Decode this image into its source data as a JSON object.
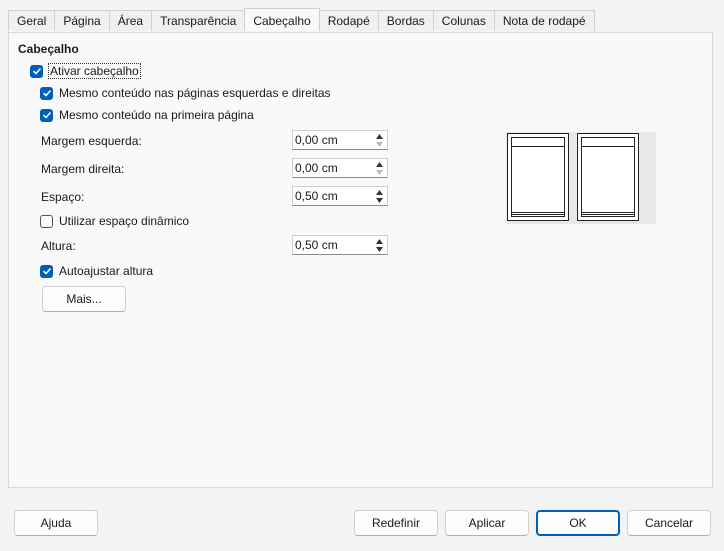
{
  "tabs": [
    "Geral",
    "Página",
    "Área",
    "Transparência",
    "Cabeçalho",
    "Rodapé",
    "Bordas",
    "Colunas",
    "Nota de rodapé"
  ],
  "active_tab": "Cabeçalho",
  "section_title": "Cabeçalho",
  "checkboxes": {
    "ativar": {
      "label": "Ativar cabeçalho",
      "checked": true
    },
    "mesmo_lados": {
      "label": "Mesmo conteúdo nas páginas esquerdas e direitas",
      "checked": true
    },
    "mesmo_primeira": {
      "label": "Mesmo conteúdo na primeira página",
      "checked": true
    },
    "dinamico": {
      "label": "Utilizar espaço dinâmico",
      "checked": false
    },
    "autoajustar": {
      "label": "Autoajustar altura",
      "checked": true
    }
  },
  "fields": {
    "margem_esquerda": {
      "label": "Margem esquerda:",
      "value": "0,00 cm"
    },
    "margem_direita": {
      "label": "Margem direita:",
      "value": "0,00 cm"
    },
    "espaco": {
      "label": "Espaço:",
      "value": "0,50 cm"
    },
    "altura": {
      "label": "Altura:",
      "value": "0,50 cm"
    }
  },
  "mais_button": "Mais...",
  "footer_buttons": {
    "ajuda": "Ajuda",
    "redefinir": "Redefinir",
    "aplicar": "Aplicar",
    "ok": "OK",
    "cancelar": "Cancelar"
  },
  "colors": {
    "accent": "#005fb8",
    "background": "#f3f3f3"
  }
}
